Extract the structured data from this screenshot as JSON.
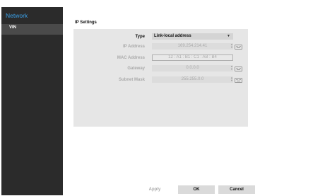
{
  "sidebar": {
    "header": "Network",
    "items": [
      {
        "label": "VIN"
      }
    ]
  },
  "main": {
    "section_title": "IP Settings",
    "fields": {
      "type": {
        "label": "Type",
        "value": "Link-local address"
      },
      "ip": {
        "label": "IP Address",
        "value": "169.254.214.41"
      },
      "mac": {
        "label": "MAC Address",
        "value": "12 : A1 : B1 : C1 : AB : B4"
      },
      "gateway": {
        "label": "Gateway",
        "value": "0.0.0.0"
      },
      "subnet": {
        "label": "Subnet Mask",
        "value": "255.255.0.0"
      }
    }
  },
  "footer": {
    "apply": "Apply",
    "ok": "OK",
    "cancel": "Cancel"
  },
  "colors": {
    "sidebar_bg": "#2b2b2b",
    "accent": "#3aa0e8",
    "panel_bg": "#e6e6e6",
    "button_bg": "#dadada"
  },
  "icons": [
    "chevron-down-icon",
    "stepper-icon",
    "keyboard-icon"
  ]
}
